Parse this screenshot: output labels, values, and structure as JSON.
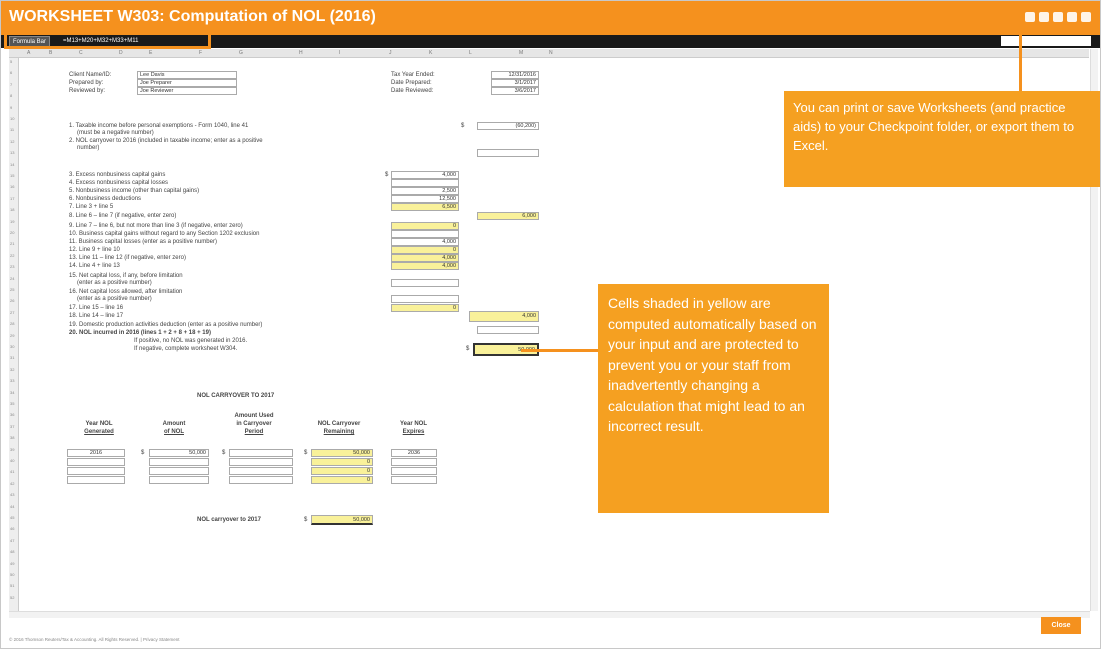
{
  "window": {
    "title": "WORKSHEET W303: Computation of NOL (2016)"
  },
  "formula_bar": {
    "label": "Formula Bar",
    "value": "=M13+M20+M32+M33+M11"
  },
  "columns": [
    "A",
    "B",
    "C",
    "D",
    "E",
    "F",
    "G",
    "H",
    "I",
    "J",
    "K",
    "L",
    "M",
    "N"
  ],
  "rows": [
    "5",
    "6",
    "7",
    "8",
    "9",
    "10",
    "11",
    "12",
    "13",
    "14",
    "15",
    "16",
    "17",
    "18",
    "19",
    "20",
    "21",
    "22",
    "23",
    "24",
    "25",
    "26",
    "27",
    "28",
    "29",
    "30",
    "31",
    "32",
    "33",
    "34",
    "35",
    "36",
    "37",
    "38",
    "39",
    "40",
    "41",
    "42",
    "43",
    "44",
    "45",
    "46",
    "47",
    "48",
    "49",
    "50",
    "51",
    "52"
  ],
  "header": {
    "client_label": "Client Name/ID:",
    "client_value": "Lee Davis",
    "prepared_label": "Prepared by:",
    "prepared_value": "Joe Preparer",
    "reviewed_label": "Reviewed by:",
    "reviewed_value": "Joe Reviewer",
    "tax_year_label": "Tax Year Ended:",
    "tax_year_value": "12/31/2016",
    "date_prepared_label": "Date Prepared:",
    "date_prepared_value": "3/1/2017",
    "date_reviewed_label": "Date Reviewed:",
    "date_reviewed_value": "3/6/2017"
  },
  "lines": {
    "l1": "1. Taxable income before personal exemptions - Form 1040, line 41",
    "l1b": "(must be a negative number)",
    "l1_val": "(60,200)",
    "l2": "2. NOL carryover to 2016 (included in taxable income; enter as a positive",
    "l2b": "number)",
    "l3": "3. Excess nonbusiness capital gains",
    "l3_val": "4,000",
    "l4": "4. Excess nonbusiness capital losses",
    "l5": "5. Nonbusiness income (other than capital gains)",
    "l5_val": "2,500",
    "l6": "6. Nonbusiness deductions",
    "l6_val": "12,500",
    "l7": "7. Line 3 + line 5",
    "l7_val": "6,500",
    "l8": "8. Line 6 – line 7 (if negative, enter zero)",
    "l8_val": "6,000",
    "l9": "9. Line 7 – line 6, but not more than line 3 (if negative, enter zero)",
    "l9_val": "0",
    "l10": "10. Business capital gains without regard to any Section 1202 exclusion",
    "l11": "11. Business capital losses (enter as a positive number)",
    "l11_val": "4,000",
    "l12": "12. Line 9 + line 10",
    "l12_val": "0",
    "l13": "13. Line 11 – line 12 (if negative, enter zero)",
    "l13_val": "4,000",
    "l14": "14. Line 4 + line 13",
    "l14_val": "4,000",
    "l15": "15. Net capital loss, if any, before limitation",
    "l15b": "(enter as a positive number)",
    "l16": "16. Net capital loss allowed, after limitation",
    "l16b": "(enter as a positive number)",
    "l17": "17. Line 15 – line 16",
    "l17_val": "0",
    "l18": "18. Line 14 – line 17",
    "l18_val": "4,000",
    "l19": "19. Domestic production activities deduction (enter as a positive number)",
    "l20": "20. NOL incurred in 2016 (lines 1 + 2 + 8 + 18 + 19)",
    "l20_val": "50,000",
    "note1": "If positive, no NOL was generated in 2016.",
    "note2": "If negative, complete worksheet W304."
  },
  "carryover": {
    "title": "NOL CARRYOVER TO 2017",
    "col_year": [
      "Year NOL",
      "Generated"
    ],
    "col_amount": [
      "Amount",
      "of NOL"
    ],
    "col_used": [
      "Amount Used",
      "in Carryover",
      "Period"
    ],
    "col_remaining": [
      "NOL Carryover",
      "Remaining"
    ],
    "col_expires": [
      "Year NOL",
      "Expires"
    ],
    "row1": {
      "year": "2016",
      "amount": "50,000",
      "remaining": "50,000",
      "expires": "2036"
    },
    "zeros": [
      "0",
      "0",
      "0"
    ],
    "total_label": "NOL carryover to 2017",
    "total_value": "50,000",
    "dollar": "$"
  },
  "callouts": {
    "print": "You can print or save Worksheets (and practice aids) to your Checkpoint folder, or export them to Excel.",
    "yellow": "Cells shaded in yellow are computed automatically based on your input and are protected to prevent you or your staff from inadvertently changing a calculation that might lead to an incorrect result."
  },
  "footer": {
    "text": "© 2016 Thomson Reuters/Tax & Accounting. All Rights Reserved.  |  Privacy Statement"
  },
  "close_button": {
    "label": "Close"
  },
  "colors": {
    "accent": "#f5911e",
    "yellow_cell": "#f9f19a"
  },
  "icons": [
    "print-icon",
    "save-icon",
    "export-icon",
    "help-icon",
    "close-icon"
  ]
}
